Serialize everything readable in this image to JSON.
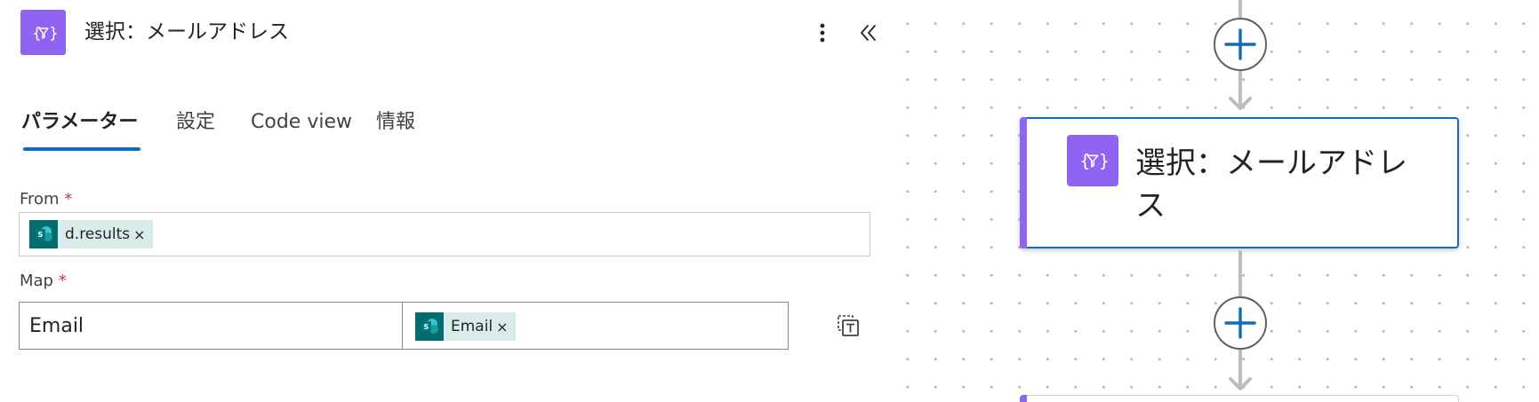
{
  "panel": {
    "title": "選択：メールアドレス",
    "icon": "data-operation-icon",
    "more_icon": "more-vertical-icon",
    "collapse_icon": "double-chevron-left-icon"
  },
  "tabs": [
    {
      "label": "パラメーター",
      "active": true
    },
    {
      "label": "設定",
      "active": false
    },
    {
      "label": "Code view",
      "active": false
    },
    {
      "label": "情報",
      "active": false
    }
  ],
  "from_field": {
    "label": "From",
    "required_mark": "*",
    "token": {
      "icon": "sharepoint-icon",
      "text": "d.results",
      "remove": "×"
    }
  },
  "map_field": {
    "label": "Map",
    "required_mark": "*",
    "key_value": "Email",
    "value_token": {
      "icon": "sharepoint-icon",
      "text": "Email",
      "remove": "×"
    },
    "switch_icon": "switch-to-text-mode-icon"
  },
  "canvas": {
    "add_icon": "plus-icon",
    "node": {
      "title": "選択：メールアドレス",
      "icon": "data-operation-icon",
      "selected": true
    }
  },
  "colors": {
    "accent": "#0f6cbd",
    "data_operation": "#8f64f2",
    "sharepoint": "#036c70",
    "token_bg": "#daece9",
    "required": "#c4314b"
  }
}
